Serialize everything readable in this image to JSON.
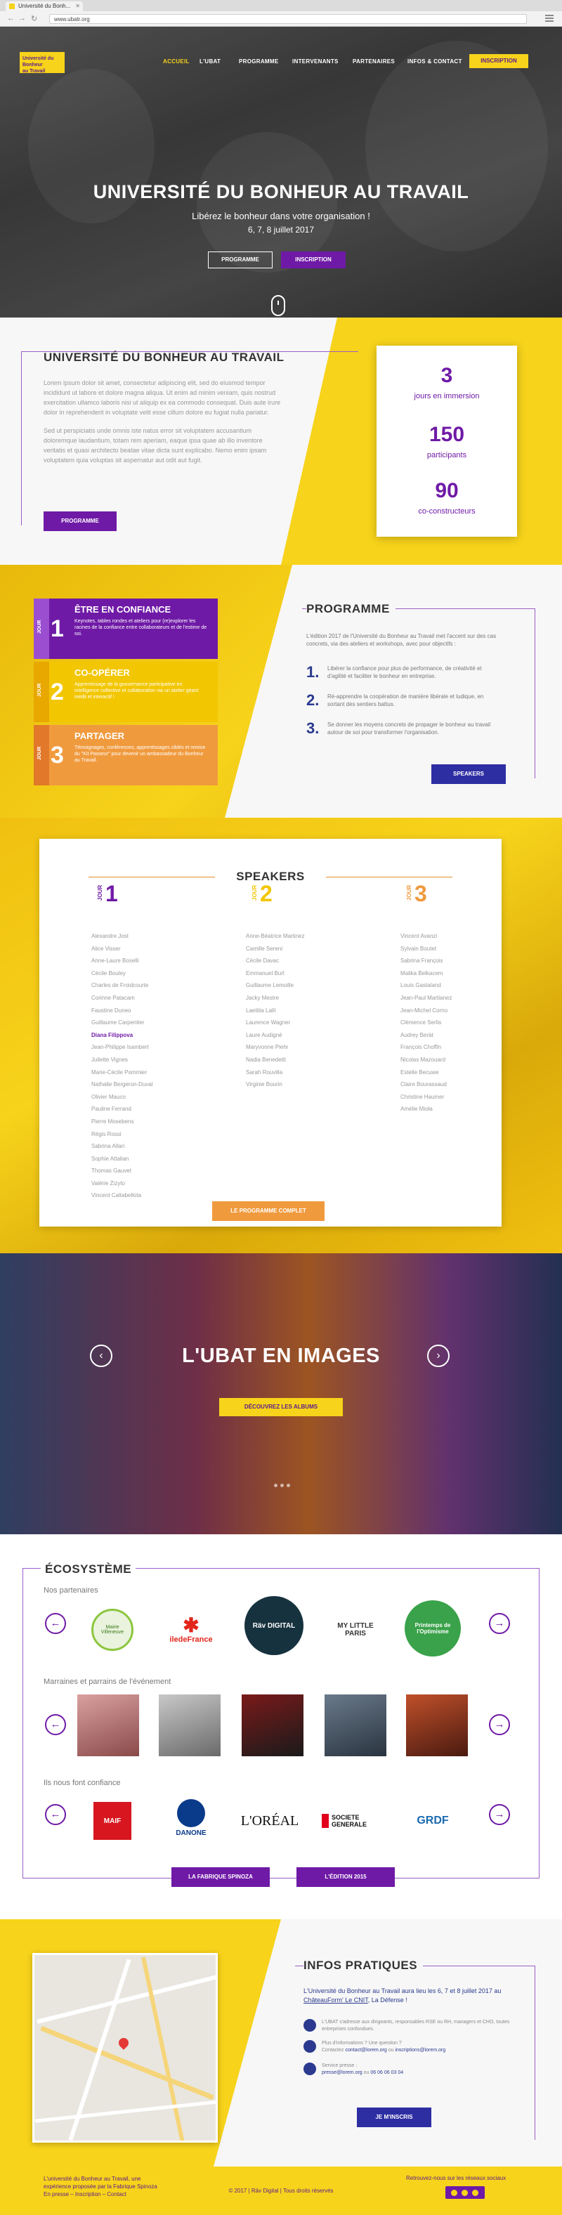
{
  "browser": {
    "tab_title": "Université du Bonh...",
    "url": "www.ubatr.org"
  },
  "nav": {
    "logo_lines": [
      "Université du",
      "Bonheur",
      "au Travail"
    ],
    "items": [
      "ACCUEIL",
      "L'UBAT",
      "PROGRAMME",
      "INTERVENANTS",
      "PARTENAIRES",
      "INFOS & CONTACT"
    ],
    "cta": "INSCRIPTION"
  },
  "hero": {
    "title": "UNIVERSITÉ DU BONHEUR AU TRAVAIL",
    "subtitle": "Libérez le bonheur dans votre organisation !",
    "date": "6, 7, 8 juillet 2017",
    "btn_programme": "PROGRAMME",
    "btn_inscription": "INSCRIPTION"
  },
  "about": {
    "title": "UNIVERSITÉ DU BONHEUR AU TRAVAIL",
    "para1": "Lorem ipsum dolor sit amet, consectetur adipiscing elit, sed do eiusmod tempor incididunt ut labore et dolore magna aliqua. Ut enim ad minim veniam, quis nostrud exercitation ullamco laboris nisi ut aliquip ex ea commodo consequat. Duis aute irure dolor in reprehenderit in voluptate velit esse cillum dolore eu fugiat nulla pariatur.",
    "para2": "Sed ut perspiciatis unde omnis iste natus error sit voluptatem accusantium doloremque laudantium, totam rem aperiam, eaque ipsa quae ab illo inventore veritatis et quasi architecto beatae vitae dicta sunt explicabo. Nemo enim ipsam voluptatem quia voluptas sit aspernatur aut odit aut fugit.",
    "btn": "PROGRAMME",
    "stats": [
      {
        "num": "3",
        "label": "jours en immersion"
      },
      {
        "num": "150",
        "label": "participants"
      },
      {
        "num": "90",
        "label": "co-constructeurs"
      }
    ]
  },
  "programme": {
    "title": "PROGRAMME",
    "intro": "L'édition 2017 de l'Université du Bonheur au Travail met l'accent sur des cas concrets, via des ateliers et workshops, avec pour objectifs :",
    "items": [
      {
        "num": "1.",
        "text": "Libérer la confiance pour plus de performance, de créativité et d'agilité et faciliter le bonheur en entreprise."
      },
      {
        "num": "2.",
        "text": "Ré-apprendre la coopération de manière libérale et ludique, en sortant des sentiers battus."
      },
      {
        "num": "3.",
        "text": "Se donner les moyens concrets de propager le bonheur au travail autour de soi pour transformer l'organisation."
      }
    ],
    "btn": "SPEAKERS",
    "cards": [
      {
        "jour": "JOUR",
        "num": "1",
        "title": "ÊTRE EN CONFIANCE",
        "desc": "Keynotes, tables rondes et ateliers pour (re)explorer les racines de la confiance entre collaborateurs et de l'estime de soi.",
        "color": "#6f1aa6",
        "tag": "#9b4fd0"
      },
      {
        "jour": "JOUR",
        "num": "2",
        "title": "CO-OPÉRER",
        "desc": "Apprentissage de la gouvernance participative en intelligence collective et collaboration via un atelier géant inédit et interactif !",
        "color": "#f2c600",
        "tag": "#e8a800"
      },
      {
        "jour": "JOUR",
        "num": "3",
        "title": "PARTAGER",
        "desc": "Témoignages, conférences, apprentissages ciblés et remise du \"Kit Passeur\" pour devenir un ambassadeur du Bonheur au Travail.",
        "color": "#f09a3e",
        "tag": "#e2782a"
      }
    ]
  },
  "speakers": {
    "title": "SPEAKERS",
    "columns": [
      {
        "jour": "JOUR",
        "num": "1",
        "color": "#6f1aa6",
        "names": [
          "Alexandre Jost",
          "Alice Visser",
          "Anne-Laure Boselli",
          "Cécile Bouley",
          "Charles de Froidcourte",
          "Corinne Patacam",
          "Faustine Duneo",
          "Guillaume Carpentier",
          "Diana Filippova",
          "Jean-Philippe Isambert",
          "Juliette Vignes",
          "Marie-Cécile Pommier",
          "Nathalie Bergeron-Duval",
          "Olivier Mauco",
          "Pauline Ferrand",
          "Pierre Mosebens",
          "Régis Rossi",
          "Sabrina Allari",
          "Sophie Attalian",
          "Thomas Gauvet",
          "Valérie Zizyto",
          "Vincent Caltabellota"
        ],
        "highlight": 8
      },
      {
        "jour": "JOUR",
        "num": "2",
        "color": "#f2c600",
        "names": [
          "Anne-Béatrice Martinez",
          "Camille Sereni",
          "Cécile Davac",
          "Emmanuel Burl",
          "Guillaume Lemoille",
          "Jacky Mestre",
          "Laetitia Lalil",
          "Laurence Wagner",
          "Laure Audigné",
          "Maryvonne Piehr",
          "Nadia Benedetti",
          "Sarah Rouvilla",
          "Virginie Bourin"
        ],
        "highlight": -1
      },
      {
        "jour": "JOUR",
        "num": "3",
        "color": "#f09a3e",
        "names": [
          "Vincent Avanzi",
          "Sylvain Boutet",
          "Sabrina François",
          "Malika Belkacem",
          "Louis Gastaland",
          "Jean-Paul Martianez",
          "Jean-Michel Corno",
          "Clémence Serlis",
          "Audrey Beràt",
          "François Choffin",
          "Nicolas Mazouard",
          "Estelle Becuwe",
          "Claire Bourassaud",
          "Christine Haumer",
          "Amélie Mioła"
        ],
        "highlight": -1
      }
    ],
    "btn": "LE PROGRAMME COMPLET"
  },
  "images": {
    "title": "L'UBAT EN IMAGES",
    "btn": "DÉCOUVREZ LES ALBUMS"
  },
  "ecosystem": {
    "title": "ÉCOSYSTÈME",
    "partners_title": "Nos partenaires",
    "partners": [
      "Mairie Villeneuve",
      "iledeFrance",
      "Räv DIGITAL",
      "MY LITTLE PARIS",
      "Printemps de l'Optimisme"
    ],
    "sponsors_title": "Marraines et parrains de l'événement",
    "trust_title": "Ils nous font confiance",
    "trust": [
      "MAIF",
      "DANONE",
      "L'ORÉAL",
      "SOCIETE GENERALE",
      "GRDF"
    ],
    "btn1": "LA FABRIQUE SPINOZA",
    "btn2": "L'ÉDITION 2015"
  },
  "infos": {
    "title": "INFOS PRATIQUES",
    "intro_a": "L'Université du Bonheur au Travail aura lieu les 6, 7 et 8 juillet 2017 au",
    "intro_link": "ChâteauForm' Le CNIT",
    "intro_b": ", La Défense !",
    "row1": "L'UBAT s'adresse aux dirigeants, responsables RSE ou RH, managers et CHO, toutes entreprises confondues.",
    "row2_a": "Plus d'informations ? Une question ?",
    "row2_b": "Contactez",
    "row2_mail1": "contact@lorem.org",
    "row2_ou": "ou",
    "row2_mail2": "inscriptions@lorem.org",
    "row3_a": "Service presse :",
    "row3_mail": "presse@lorem.org",
    "row3_ou": "ou",
    "row3_tel": "06 06 06 03 04",
    "btn": "JE M'INSCRIS"
  },
  "footer": {
    "left": "L'université du Bonheur au Travail, une expérience proposée par la Fabrique Spinoza",
    "left_links": "En presse – Inscription – Contact",
    "mid": "© 2017 | Räv Digital | Tous droits réservés",
    "right": "Retrouvez-nous sur les réseaux sociaux"
  }
}
